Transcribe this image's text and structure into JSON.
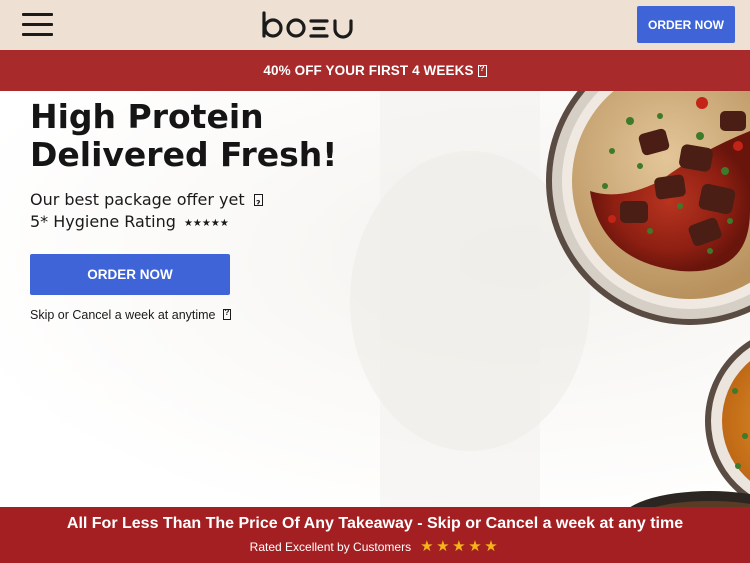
{
  "header": {
    "logo_text": "bozu",
    "order_button": "ORDER NOW",
    "menu_icon": "hamburger-menu-icon"
  },
  "promo": {
    "text": "40% OFF YOUR FIRST 4 WEEKS",
    "icon": "missing-glyph-icon"
  },
  "hero": {
    "title_line1": "High Protein",
    "title_line2": "Delivered Fresh!",
    "offer": "Our best package offer yet",
    "hygiene": "5* Hygiene Rating",
    "hygiene_stars": "★★★★★",
    "order_button": "ORDER NOW",
    "skip_text": "Skip or Cancel a week at anytime",
    "image": "food-bowl-image"
  },
  "banner": {
    "title": "All For Less Than The Price Of Any Takeaway - Skip or Cancel a week at any time",
    "rated": "Rated Excellent by Customers",
    "rating": 5,
    "star_color": "#f3b51a"
  },
  "colors": {
    "header_bg": "#eee1d4",
    "promo_bg": "#a82a2a",
    "button_blue": "#3e64d8",
    "banner_bg": "#a41f22"
  }
}
